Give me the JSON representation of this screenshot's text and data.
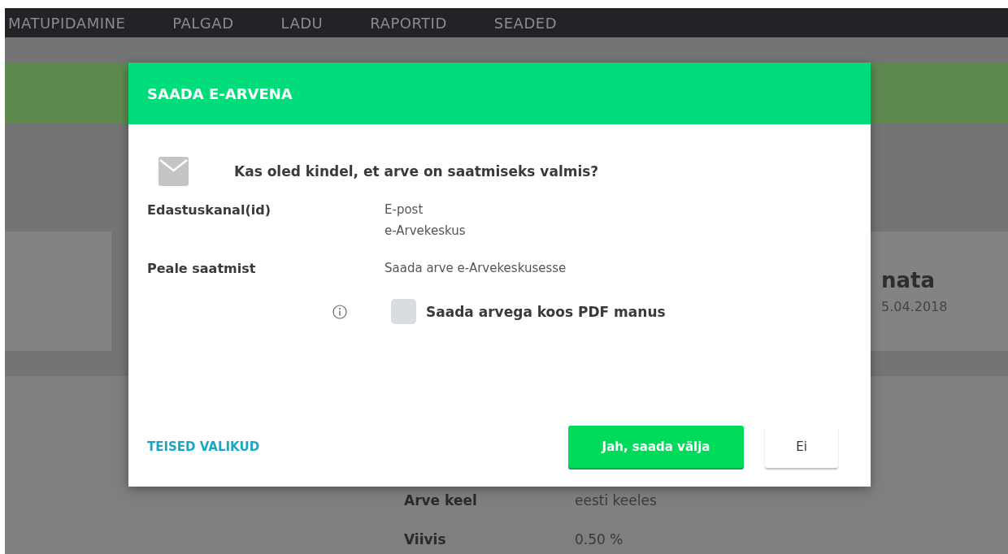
{
  "nav": {
    "items": [
      "MATUPIDAMINE",
      "PALGAD",
      "LADU",
      "RAPORTID",
      "SEADED"
    ]
  },
  "page": {
    "status_title": "nata",
    "status_date": "5.04.2018",
    "details": [
      {
        "label": "Arve keel",
        "value": "eesti keeles"
      },
      {
        "label": "Viivis",
        "value": "0.50 %"
      }
    ]
  },
  "dialog": {
    "title": "SAADA E-ARVENA",
    "question": "Kas oled kindel, et arve on saatmiseks valmis?",
    "fields": [
      {
        "label": "Edastuskanal(id)",
        "values": [
          "E-post",
          "e-Arvekeskus"
        ]
      },
      {
        "label": "Peale saatmist",
        "values": [
          "Saada arve e-Arvekeskusesse"
        ]
      }
    ],
    "pdf_option": {
      "label": "Saada arvega koos PDF manus",
      "checked": false
    },
    "link": "TEISED VALIKUD",
    "buttons": [
      {
        "label": "Jah, saada välja",
        "kind": "primary"
      },
      {
        "label": "Ei",
        "kind": "secondary"
      }
    ]
  }
}
